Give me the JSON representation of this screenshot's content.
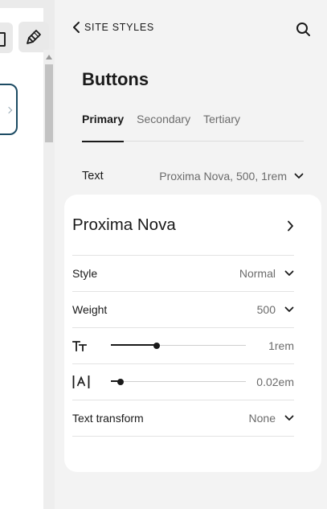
{
  "canvas": {
    "icons": [
      "frame-icon",
      "paintbrush-icon"
    ]
  },
  "panel": {
    "back_label": "SITE STYLES",
    "title": "Buttons",
    "tabs": [
      {
        "label": "Primary",
        "active": true
      },
      {
        "label": "Secondary",
        "active": false
      },
      {
        "label": "Tertiary",
        "active": false
      }
    ],
    "text_setting": {
      "label": "Text",
      "value": "Proxima Nova, 500, 1rem"
    }
  },
  "font_card": {
    "font_name": "Proxima Nova",
    "style": {
      "label": "Style",
      "value": "Normal"
    },
    "weight": {
      "label": "Weight",
      "value": "500"
    },
    "font_size": {
      "value": "1rem",
      "fraction": 0.34
    },
    "letter_spacing": {
      "value": "0.02em",
      "fraction": 0.07
    },
    "text_transform": {
      "label": "Text transform",
      "value": "None"
    }
  },
  "colors": {
    "accent": "#1a1a1a",
    "preview_border": "#1c4b63",
    "panel_bg": "#f3f3f3",
    "card_bg": "#ffffff"
  }
}
